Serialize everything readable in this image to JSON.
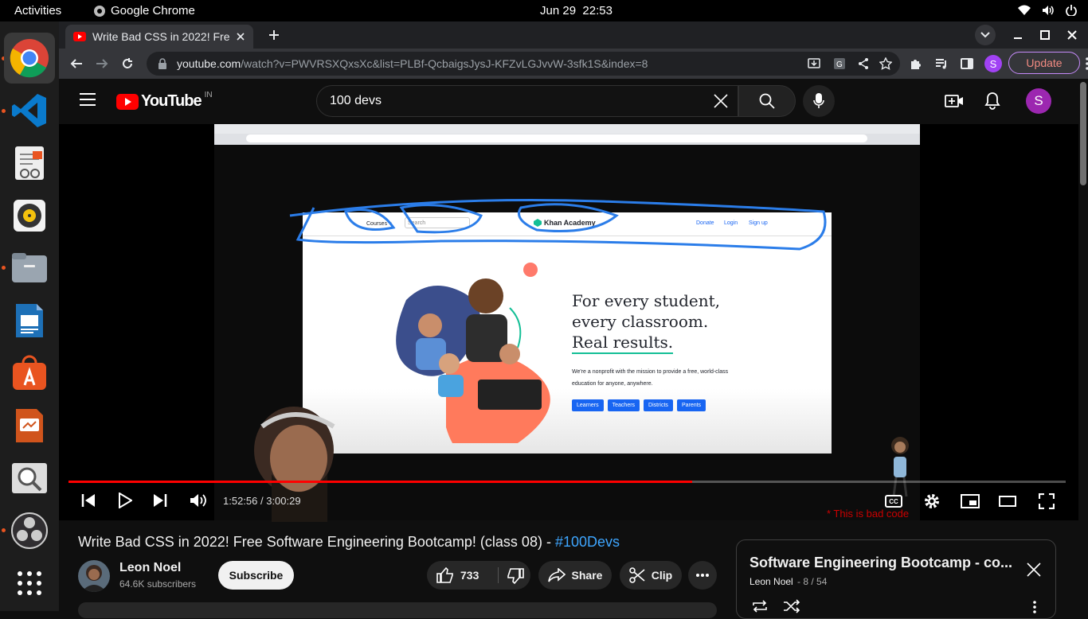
{
  "system": {
    "activities": "Activities",
    "app_name": "Google Chrome",
    "date": "Jun 29",
    "time": "22:53"
  },
  "dock": {
    "items": [
      "chrome-icon",
      "vscode-icon",
      "text-editor-icon",
      "rhythmbox-icon",
      "files-icon",
      "writer-icon",
      "app-center-icon",
      "impress-icon",
      "image-viewer-icon",
      "obs-icon",
      "show-apps-icon"
    ]
  },
  "browser": {
    "tab_title": "Write Bad CSS in 2022! Fre",
    "url_host": "youtube.com",
    "url_path": "/watch?v=PWVRSXQxsXc&list=PLBf-QcbaigsJysJ-KFZvLGJvvW-3sfk1S&index=8",
    "profile_initial": "S",
    "update_label": "Update"
  },
  "youtube": {
    "logo_text": "YouTube",
    "region": "IN",
    "search_value": "100 devs",
    "avatar_initial": "S",
    "player": {
      "current_time": "1:52:56",
      "duration": "3:00:29",
      "progress": 0.625,
      "cc_label": "CC",
      "overlay_note": "* This is bad code"
    },
    "slide": {
      "nav_courses": "Courses ▾",
      "nav_search": "Search",
      "brand": "Khan Academy",
      "nav_donate": "Donate",
      "nav_login": "Login",
      "nav_signup": "Sign up",
      "headline_1": "For every student,",
      "headline_2": "every classroom.",
      "headline_3": "Real results.",
      "subtext_1": "We're a nonprofit with the mission to provide a free, world-class",
      "subtext_2": "education for anyone, anywhere.",
      "buttons": [
        "Learners",
        "Teachers",
        "Districts",
        "Parents"
      ]
    },
    "video": {
      "title": "Write Bad CSS in 2022! Free Software Engineering Bootcamp! (class 08) - ",
      "hashtag": "#100Devs",
      "channel": "Leon Noel",
      "subscribers": "64.6K subscribers",
      "subscribe_label": "Subscribe",
      "likes": "733",
      "share_label": "Share",
      "clip_label": "Clip"
    },
    "playlist": {
      "title": "Software Engineering Bootcamp - co...",
      "owner": "Leon Noel",
      "position": "8 / 54"
    }
  }
}
